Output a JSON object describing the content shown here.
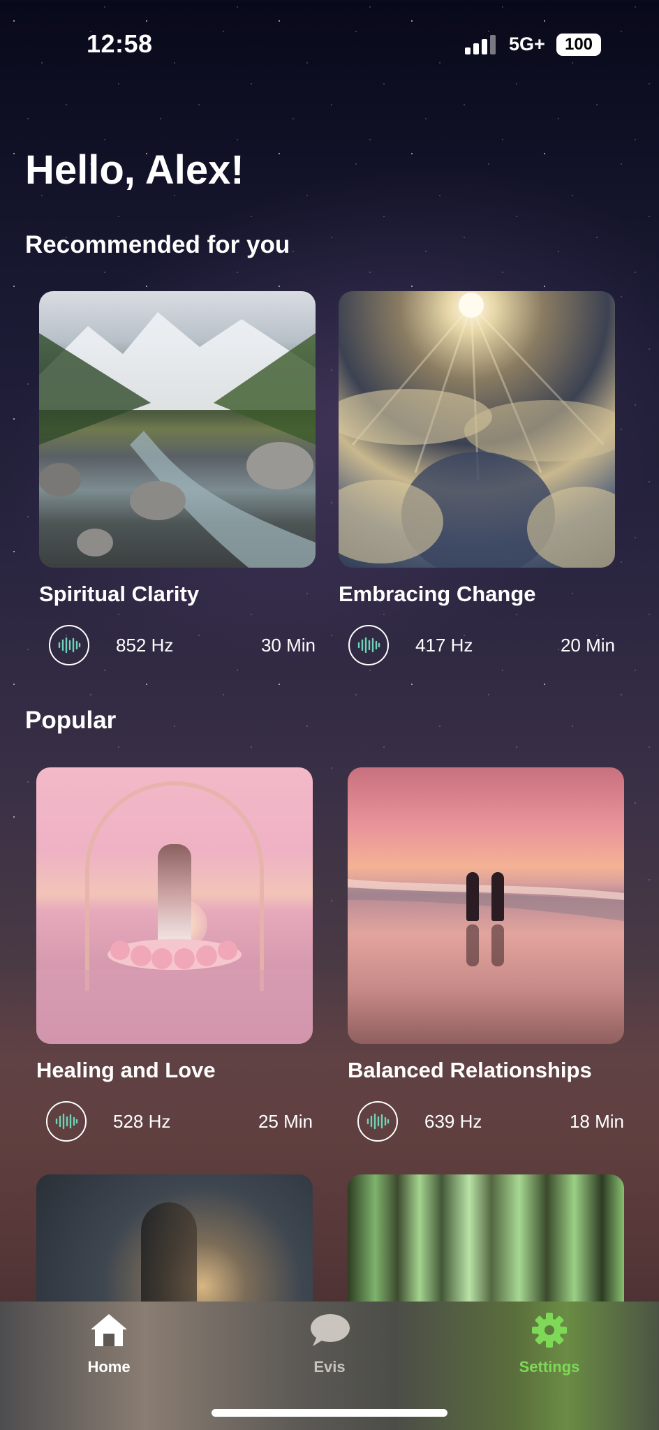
{
  "status_bar": {
    "time": "12:58",
    "network": "5G+",
    "battery": "100"
  },
  "greeting": "Hello, Alex!",
  "sections": {
    "recommended": {
      "title": "Recommended for you",
      "items": [
        {
          "title": "Spiritual Clarity",
          "frequency": "852 Hz",
          "duration": "30 Min"
        },
        {
          "title": "Embracing Change",
          "frequency": "417 Hz",
          "duration": "20 Min"
        }
      ]
    },
    "popular": {
      "title": "Popular",
      "items": [
        {
          "title": "Healing and Love",
          "frequency": "528 Hz",
          "duration": "25 Min"
        },
        {
          "title": "Balanced Relationships",
          "frequency": "639 Hz",
          "duration": "18 Min"
        }
      ]
    }
  },
  "tab_bar": {
    "items": [
      {
        "label": "Home",
        "icon": "home-icon",
        "color": "#ffffff"
      },
      {
        "label": "Evis",
        "icon": "chat-bubble-icon",
        "color": "#c9c4bd"
      },
      {
        "label": "Settings",
        "icon": "gear-icon",
        "color": "#7ed957"
      }
    ]
  },
  "colors": {
    "accent_green": "#7ed957",
    "wave_teal": "#6fd3b8"
  }
}
